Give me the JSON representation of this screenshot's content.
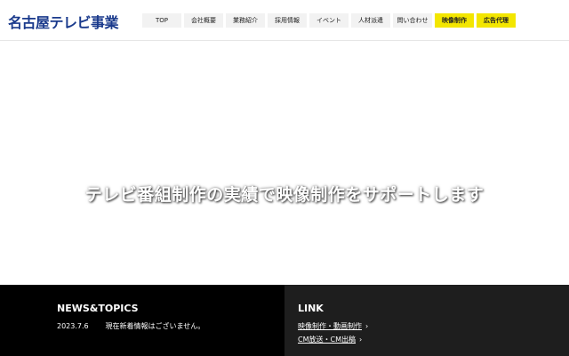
{
  "header": {
    "logo": "名古屋テレビ事業",
    "nav": [
      {
        "label": "TOP",
        "accent": false
      },
      {
        "label": "会社概要",
        "accent": false
      },
      {
        "label": "業務紹介",
        "accent": false
      },
      {
        "label": "採用情報",
        "accent": false
      },
      {
        "label": "イベント",
        "accent": false
      },
      {
        "label": "人材派遣",
        "accent": false
      },
      {
        "label": "問い合わせ",
        "accent": false
      },
      {
        "label": "映像制作",
        "accent": true
      },
      {
        "label": "広告代理",
        "accent": true
      }
    ]
  },
  "hero": {
    "tagline": "テレビ番組制作の実績で映像制作をサポートします"
  },
  "footer": {
    "news": {
      "title": "NEWS&TOPICS",
      "items": [
        {
          "date": "2023.7.6",
          "text": "現在新着情報はございません。"
        }
      ]
    },
    "links": {
      "title": "LINK",
      "items": [
        {
          "label": "映像制作・動画制作"
        },
        {
          "label": "CM放送・CM出稿"
        }
      ]
    }
  },
  "colors": {
    "accent": "#f3e600",
    "logo": "#1a3a8c",
    "footer_left": "#000000",
    "footer_right": "#1e1e1e"
  }
}
